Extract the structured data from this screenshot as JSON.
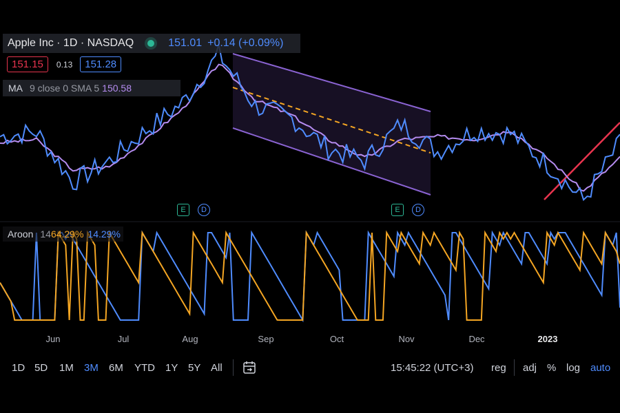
{
  "header": {
    "symbol": "Apple Inc · 1D · NASDAQ",
    "price": "151.01",
    "change": "+0.14 (+0.09%)",
    "status_color": "#2db896"
  },
  "quote": {
    "bid": "151.15",
    "spread": "0.13",
    "ask": "151.28"
  },
  "ma_legend": {
    "title": "MA",
    "params": "9 close 0 SMA 5",
    "value": "150.58"
  },
  "aroon_legend": {
    "title": "Aroon",
    "params": "14",
    "up": "64.29%",
    "down": "14.29%"
  },
  "markers": [
    {
      "letter": "E",
      "kind": "earnings"
    },
    {
      "letter": "D",
      "kind": "dividend"
    },
    {
      "letter": "E",
      "kind": "earnings"
    },
    {
      "letter": "D",
      "kind": "dividend"
    }
  ],
  "months": [
    "Jun",
    "Jul",
    "Aug",
    "Sep",
    "Oct",
    "Nov",
    "Dec",
    "2023"
  ],
  "toolbar": {
    "ranges": [
      "1D",
      "5D",
      "1M",
      "3M",
      "6M",
      "YTD",
      "1Y",
      "5Y",
      "All"
    ],
    "active_range": "3M",
    "time": "15:45:22 (UTC+3)",
    "reg": "reg",
    "adj": "adj",
    "pct": "%",
    "log": "log",
    "auto": "auto"
  },
  "colors": {
    "price": "#4f8cff",
    "ma": "#b58cf0",
    "aroon_up": "#f5a623",
    "aroon_down": "#4f8cff",
    "channel": "#8a63d2",
    "trend_dashed": "#f5a623",
    "trend_red": "#e8344e"
  },
  "chart_data": {
    "type": "line",
    "series": [
      {
        "name": "Price",
        "x": [
          "May 23",
          "Jun 1",
          "Jun 13",
          "Jul 1",
          "Jul 15",
          "Aug 1",
          "Aug 17",
          "Sep 1",
          "Sep 13",
          "Oct 3",
          "Oct 14",
          "Oct 24",
          "Nov 3",
          "Nov 10",
          "Dec 1",
          "Dec 15",
          "Dec 28",
          "Jan 13"
        ],
        "y": [
          147.0,
          148.5,
          132.0,
          139.0,
          149.0,
          158.0,
          174.0,
          157.0,
          153.0,
          143.0,
          139.0,
          151.0,
          142.0,
          149.0,
          148.0,
          138.0,
          126.0,
          145.0
        ]
      },
      {
        "name": "MA 9 close",
        "x": [
          "May 23",
          "Jun 1",
          "Jun 13",
          "Jul 1",
          "Jul 15",
          "Aug 1",
          "Aug 17",
          "Sep 1",
          "Sep 13",
          "Oct 3",
          "Oct 14",
          "Oct 24",
          "Nov 3",
          "Nov 10",
          "Dec 1",
          "Dec 15",
          "Dec 28",
          "Jan 13"
        ],
        "y": [
          145.0,
          146.0,
          136.0,
          137.0,
          146.0,
          156.0,
          171.0,
          159.0,
          154.0,
          146.0,
          140.0,
          146.0,
          147.0,
          146.0,
          149.0,
          140.0,
          129.0,
          140.0
        ]
      }
    ],
    "aroon": {
      "length": 14,
      "up_last": 64.29,
      "down_last": 14.29
    },
    "annotations": [
      "descending parallel channel Aug–Nov",
      "dashed trend line Aug–Nov",
      "red trend line Jan 2023"
    ]
  }
}
